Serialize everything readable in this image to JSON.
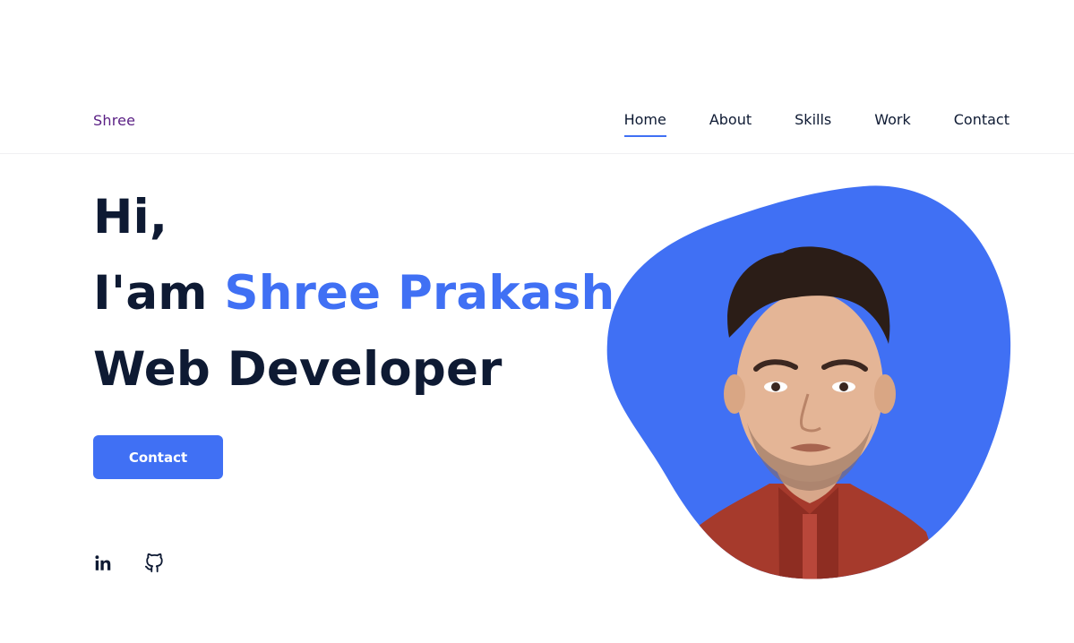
{
  "header": {
    "logo": "Shree",
    "nav": [
      {
        "label": "Home",
        "active": true
      },
      {
        "label": "About",
        "active": false
      },
      {
        "label": "Skills",
        "active": false
      },
      {
        "label": "Work",
        "active": false
      },
      {
        "label": "Contact",
        "active": false
      }
    ]
  },
  "hero": {
    "greeting": "Hi,",
    "intro_prefix": "I'am ",
    "name": "Shree Prakash",
    "role": "Web Developer",
    "contact_button": "Contact"
  },
  "socials": [
    {
      "icon": "linkedin-icon"
    },
    {
      "icon": "github-icon"
    }
  ],
  "colors": {
    "accent": "#4070f4",
    "logo": "#5a1f84",
    "text": "#0e1a33"
  }
}
